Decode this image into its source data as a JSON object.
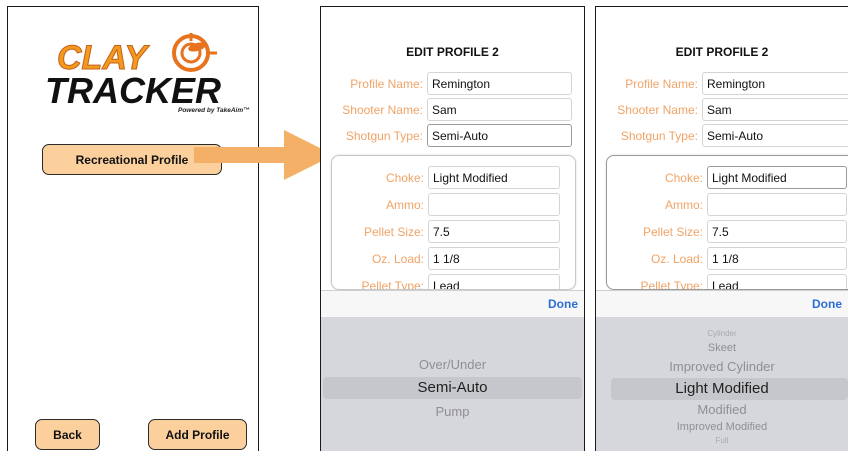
{
  "screen1": {
    "logo": {
      "line1": "CLAY",
      "line2": "TRACKER",
      "tagline": "Powered by TakeAim™"
    },
    "recreational_button": "Recreational Profile",
    "back_button": "Back",
    "add_profile_button": "Add Profile"
  },
  "screen2": {
    "title": "EDIT PROFILE 2",
    "fields": [
      {
        "label": "Profile Name:",
        "value": "Remington"
      },
      {
        "label": "Shooter Name:",
        "value": "Sam"
      },
      {
        "label": "Shotgun Type:",
        "value": "Semi-Auto"
      }
    ],
    "card_fields": [
      {
        "label": "Choke:",
        "value": "Light Modified"
      },
      {
        "label": "Ammo:",
        "value": ""
      },
      {
        "label": "Pellet Size:",
        "value": "7.5"
      },
      {
        "label": "Oz. Load:",
        "value": "1 1/8"
      },
      {
        "label": "Pellet Type:",
        "value": "Lead"
      }
    ],
    "done_label": "Done",
    "picker_options": [
      "Over/Under",
      "Semi-Auto",
      "Pump"
    ],
    "picker_selected": "Semi-Auto"
  },
  "screen3": {
    "title": "EDIT PROFILE 2",
    "fields": [
      {
        "label": "Profile Name:",
        "value": "Remington"
      },
      {
        "label": "Shooter Name:",
        "value": "Sam"
      },
      {
        "label": "Shotgun Type:",
        "value": "Semi-Auto"
      }
    ],
    "card_fields": [
      {
        "label": "Choke:",
        "value": "Light Modified"
      },
      {
        "label": "Ammo:",
        "value": ""
      },
      {
        "label": "Pellet Size:",
        "value": "7.5"
      },
      {
        "label": "Oz. Load:",
        "value": "1 1/8"
      },
      {
        "label": "Pellet Type:",
        "value": "Lead"
      }
    ],
    "done_label": "Done",
    "picker_options": [
      "Cylinder",
      "Skeet",
      "Improved Cylinder",
      "Light Modified",
      "Modified",
      "Improved Modified",
      "Full"
    ],
    "picker_selected": "Light Modified"
  },
  "colors": {
    "label_orange": "#f0a366",
    "button_fill": "#fbd09c",
    "logo_orange": "#f39a1e",
    "done_blue": "#2b6fd6",
    "picker_bg": "#d6d7dc"
  }
}
